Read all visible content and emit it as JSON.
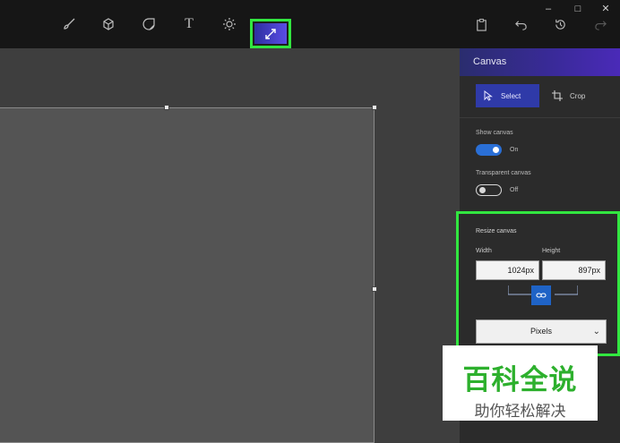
{
  "window": {
    "minimize_glyph": "–",
    "maximize_glyph": "□",
    "close_glyph": "✕"
  },
  "toolbar": {
    "tools": [
      {
        "name": "brushes-tool",
        "icon": "brush-icon"
      },
      {
        "name": "3d-shapes-tool",
        "icon": "cube-icon"
      },
      {
        "name": "stickers-tool",
        "icon": "sticker-icon"
      },
      {
        "name": "text-tool",
        "icon": "text-icon",
        "glyph": "T"
      },
      {
        "name": "effects-tool",
        "icon": "sun-icon"
      },
      {
        "name": "canvas-tool",
        "icon": "resize-arrows-icon",
        "active": true
      }
    ],
    "right_tools": [
      {
        "name": "paste",
        "icon": "clipboard-icon"
      },
      {
        "name": "undo",
        "icon": "undo-icon"
      },
      {
        "name": "history",
        "icon": "history-icon"
      },
      {
        "name": "redo",
        "icon": "redo-icon"
      }
    ]
  },
  "panel": {
    "title": "Canvas",
    "select_label": "Select",
    "crop_label": "Crop",
    "show_canvas_label": "Show canvas",
    "show_canvas_state": "On",
    "show_canvas_on": true,
    "transparent_canvas_label": "Transparent canvas",
    "transparent_canvas_state": "Off",
    "transparent_canvas_on": false
  },
  "resize": {
    "title": "Resize canvas",
    "width_label": "Width",
    "height_label": "Height",
    "width_value": "1024px",
    "height_value": "897px",
    "aspect_locked": true,
    "units_value": "Pixels"
  },
  "watermark": {
    "title": "百科全说",
    "subtitle": "助你轻松解决"
  },
  "colors": {
    "accent": "#2a6fd6",
    "highlight": "#32e640",
    "header_gradient_start": "#2a2d6e",
    "header_gradient_end": "#4a2ab8",
    "watermark_green": "#2db02d"
  }
}
